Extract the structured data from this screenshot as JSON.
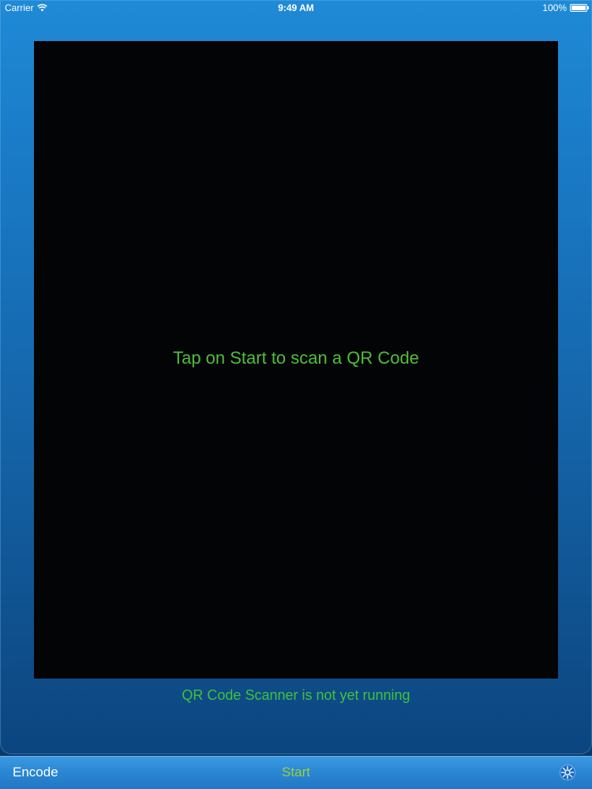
{
  "status_bar": {
    "carrier": "Carrier",
    "time": "9:49 AM",
    "battery": "100%",
    "wifi_icon": "wifi-icon",
    "battery_icon": "battery-icon"
  },
  "camera": {
    "message": "Tap on Start to scan a QR Code"
  },
  "scanner": {
    "status": "QR Code Scanner is not yet running"
  },
  "toolbar": {
    "encode_label": "Encode",
    "start_label": "Start",
    "settings_icon": "settings-icon"
  },
  "colors": {
    "accent_green": "#4fbf3a",
    "start_green": "#9bd13c",
    "panel_blue": "#1a7bc7"
  }
}
